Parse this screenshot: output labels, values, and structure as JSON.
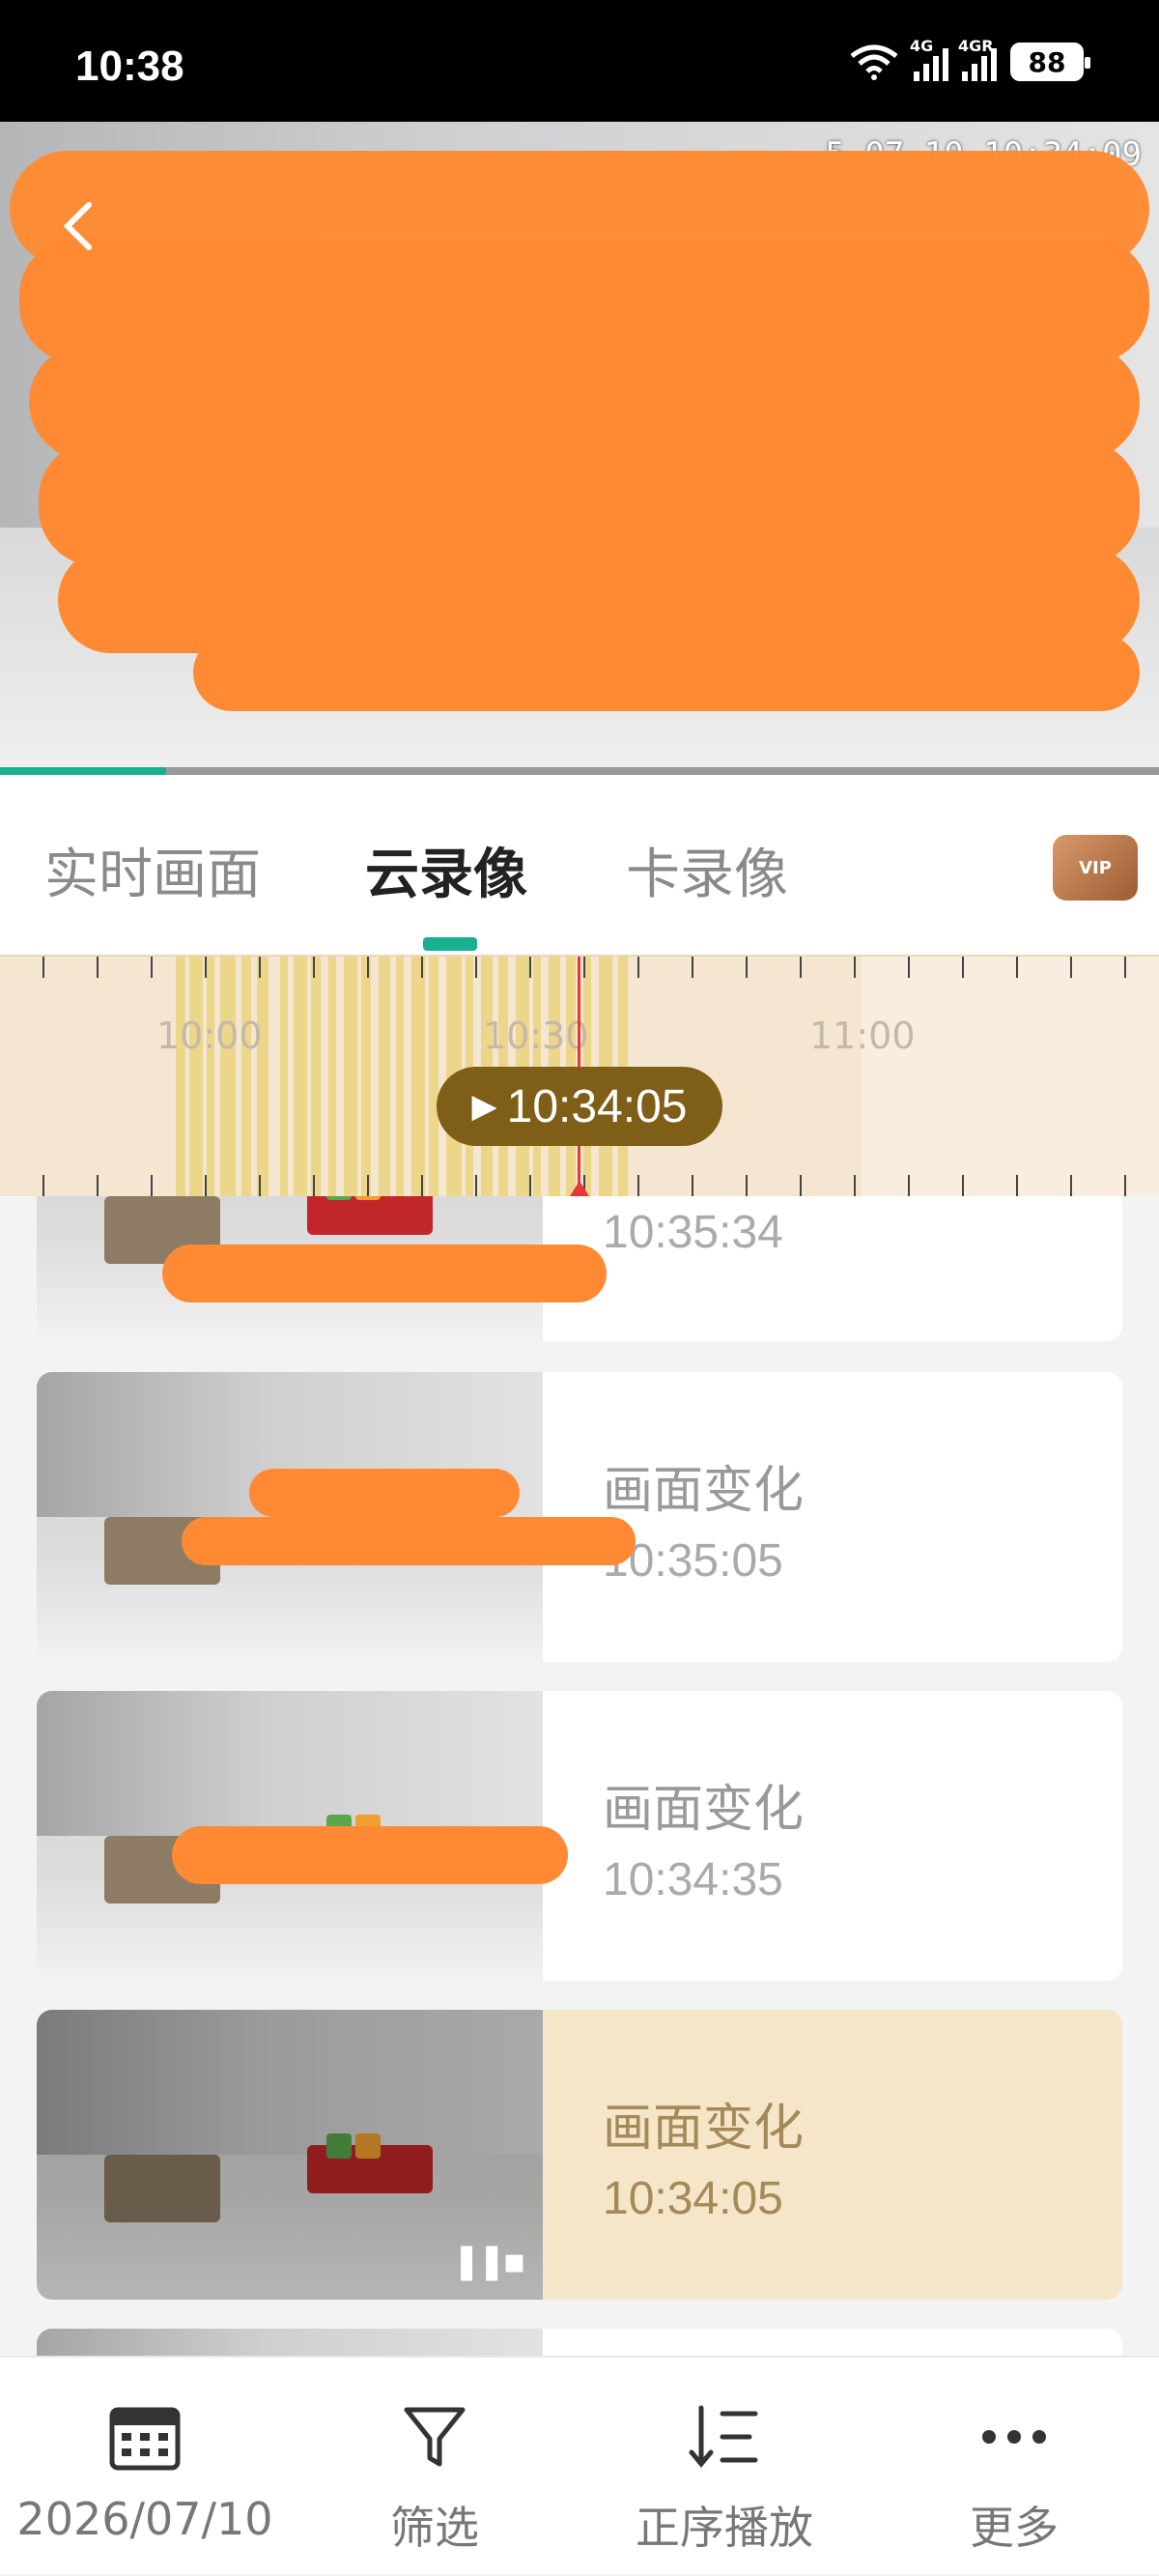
{
  "status_bar": {
    "time": "10:38",
    "battery": "88",
    "signal_1": "4G",
    "signal_2": "4GR"
  },
  "video": {
    "overlay_timestamp": "5-07-10 10:34:09"
  },
  "tabs": [
    {
      "label": "实时画面",
      "active": false
    },
    {
      "label": "云录像",
      "active": true
    },
    {
      "label": "卡录像",
      "active": false
    }
  ],
  "vip_badge": "VIP",
  "timeline": {
    "labels": [
      "10:00",
      "10:30",
      "11:00"
    ],
    "current": "10:34:05"
  },
  "recordings": [
    {
      "title": "",
      "time": "10:35:34",
      "selected": false
    },
    {
      "title": "画面变化",
      "time": "10:35:05",
      "selected": false
    },
    {
      "title": "画面变化",
      "time": "10:34:35",
      "selected": false
    },
    {
      "title": "画面变化",
      "time": "10:34:05",
      "selected": true
    }
  ],
  "bottom_bar": {
    "date": "2026/07/10",
    "filter": "筛选",
    "order": "正序播放",
    "more": "更多"
  },
  "colors": {
    "accent": "#17b190",
    "timeline_bg": "#f5e6d1",
    "pill": "#7f5f18",
    "selected_card": "#f5e6c9",
    "redaction": "#ff8a33"
  }
}
